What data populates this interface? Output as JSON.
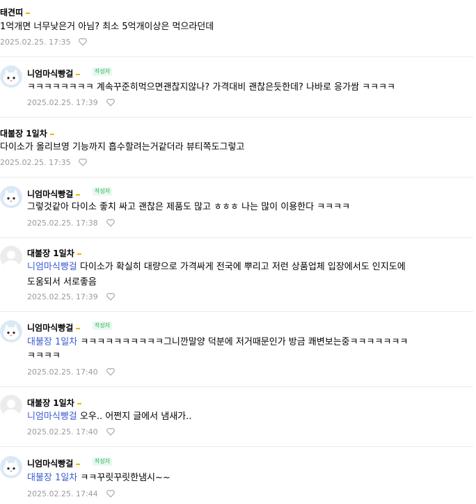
{
  "comments": [
    {
      "author": "태견띠",
      "text": "1억개면 너무낮은거 아님? 최소 5억개이상은 먹으라던데",
      "date": "2025.02.25. 17:35"
    },
    {
      "author": "니엄마식빵걸",
      "badge": "작성자",
      "text": "ㅋㅋㅋㅋㅋㅋㅋㅋ 계속꾸준히먹으면괜찮지않나? 가격대비 괜찮은듯한데? 나바로 응가쌈 ㅋㅋㅋㅋ",
      "date": "2025.02.25. 17:39"
    },
    {
      "author": "대불장 1일차",
      "text": "다이소가 올리브영 기능까지 흡수할려는거같더라 뷰티쪽도그렇고",
      "date": "2025.02.25. 17:35"
    },
    {
      "author": "니엄마식빵걸",
      "badge": "작성자",
      "text": "그렇것같아 다이소 좋치 싸고 괜찮은 제품도 많고 ㅎㅎㅎ 나는 많이 이용한다 ㅋㅋㅋㅋ",
      "date": "2025.02.25. 17:38"
    },
    {
      "author": "대불장 1일차",
      "mention": "니엄마식빵걸",
      "text_line1": " 다이소가 확실히 대량으로 가격싸게 전국에 뿌리고 저런 상품업체 입장에서도 인지도에",
      "text_line2": "도움되서 서로좋음",
      "date": "2025.02.25. 17:39"
    },
    {
      "author": "니엄마식빵걸",
      "badge": "작성자",
      "mention": "대불장 1일차",
      "text_line1": " ㅋㅋㅋㅋㅋㅋㅋㅋㅋㅋ그니깐말양 덕분에 저거때문인가 방금 쾌변보는중ㅋㅋㅋㅋㅋㅋㅋ",
      "text_line2": "ㅋㅋㅋㅋ",
      "date": "2025.02.25. 17:40"
    },
    {
      "author": "대불장 1일차",
      "mention": "니엄마식빵걸",
      "text": " 오우.. 어쩐지 글에서 냄새가..",
      "date": "2025.02.25. 17:40"
    },
    {
      "author": "니엄마식빵걸",
      "badge": "작성자",
      "mention": "대불장 1일차",
      "text": " ㅋㅋ꾸릿꾸릿한냄시~~",
      "date": "2025.02.25. 17:44"
    }
  ],
  "icons": {
    "like": "heart-outline-icon",
    "avatar_writer": "cat-avatar",
    "avatar_default": "default-user-avatar"
  },
  "colors": {
    "mention": "#3a5bd1",
    "badge": "#27b35a",
    "level_bar": "#f4b400",
    "date": "#9a9a9a"
  }
}
